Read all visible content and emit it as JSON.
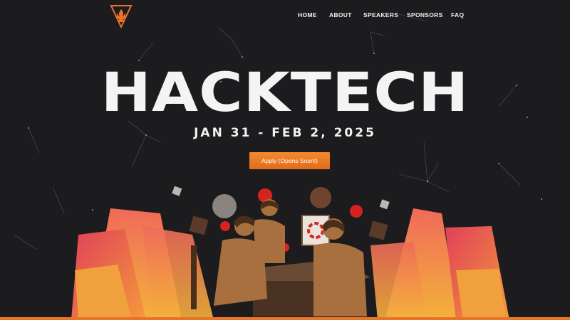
{
  "header": {
    "logo": "hacktech-flame-logo",
    "nav": [
      "HOME",
      "ABOUT",
      "SPEAKERS",
      "SPONSORS",
      "FAQ"
    ]
  },
  "hero": {
    "title": "HACKTECH",
    "date": "JAN 31 - FEB 2, 2025",
    "cta": "Apply (Opens Soon!)"
  },
  "colors": {
    "background": "#1c1c1e",
    "accent": "#e8742a",
    "text": "#f4f4f4"
  }
}
